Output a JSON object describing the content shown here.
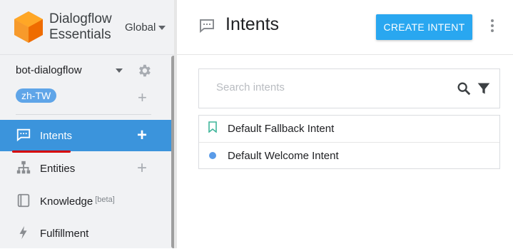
{
  "brand": {
    "line1": "Dialogflow",
    "line2": "Essentials",
    "region": "Global"
  },
  "agent": {
    "name": "bot-dialogflow",
    "language": "zh-TW"
  },
  "sidebar": {
    "items": [
      {
        "label": "Intents",
        "active": true,
        "has_add": true
      },
      {
        "label": "Entities",
        "active": false,
        "has_add": true
      },
      {
        "label": "Knowledge",
        "badge": "[beta]",
        "active": false,
        "has_add": false
      },
      {
        "label": "Fulfillment",
        "active": false,
        "has_add": false
      }
    ]
  },
  "header": {
    "title": "Intents",
    "create_label": "CREATE INTENT"
  },
  "search": {
    "placeholder": "Search intents",
    "value": ""
  },
  "intents": [
    {
      "name": "Default Fallback Intent",
      "icon": "bookmark-icon"
    },
    {
      "name": "Default Welcome Intent",
      "icon": "dot-icon"
    }
  ],
  "colors": {
    "accent": "#29a7f0",
    "active_nav": "#3b94dc",
    "chip": "#5fa5e8",
    "logo": "#f57c00",
    "underline": "#d50000"
  }
}
